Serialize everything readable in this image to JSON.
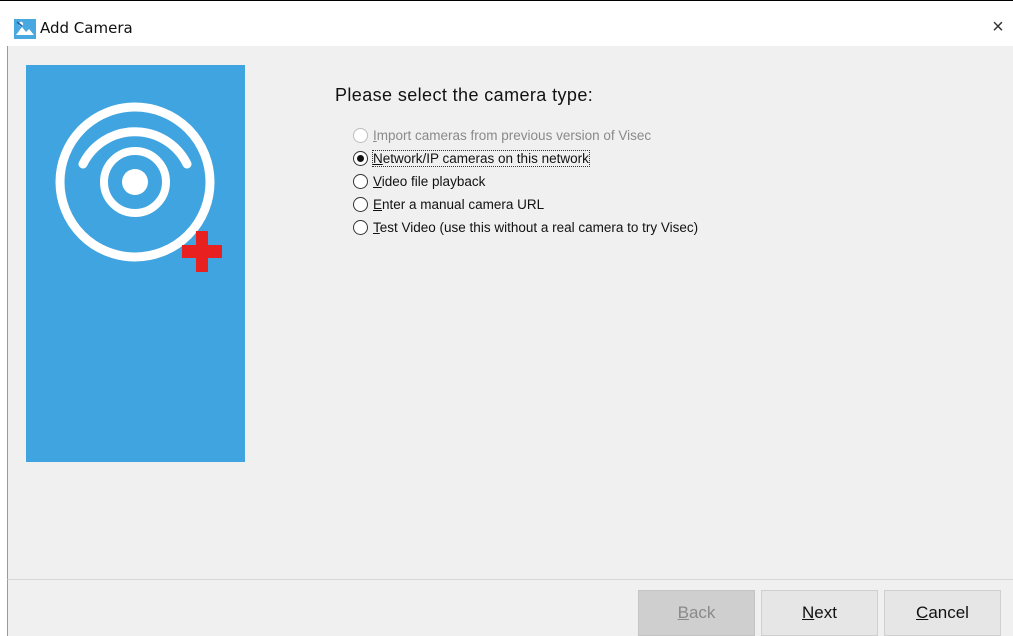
{
  "window": {
    "title": "Add Camera",
    "close_glyph": "×"
  },
  "content": {
    "heading": "Please select the camera type:",
    "options": [
      {
        "label_first": "I",
        "label_rest": "mport cameras from previous version of Visec",
        "selected": false,
        "enabled": false
      },
      {
        "label_first": "N",
        "label_rest": "etwork/IP cameras on this network",
        "selected": true,
        "enabled": true
      },
      {
        "label_first": "V",
        "label_rest": "ideo file playback",
        "selected": false,
        "enabled": true
      },
      {
        "label_first": "E",
        "label_rest": "nter a manual camera URL",
        "selected": false,
        "enabled": true
      },
      {
        "label_first": "T",
        "label_rest": "est Video (use this without a real camera to try Visec)",
        "selected": false,
        "enabled": true
      }
    ]
  },
  "buttons": {
    "back_first": "B",
    "back_rest": "ack",
    "next_first": "N",
    "next_rest": "ext",
    "cancel_first": "C",
    "cancel_rest": "ancel"
  },
  "colors": {
    "banner": "#3fa4df",
    "plus": "#e8201f",
    "background": "#f0f0f0"
  },
  "icons": [
    "app-icon",
    "close-icon",
    "camera-eye-icon",
    "plus-icon"
  ]
}
